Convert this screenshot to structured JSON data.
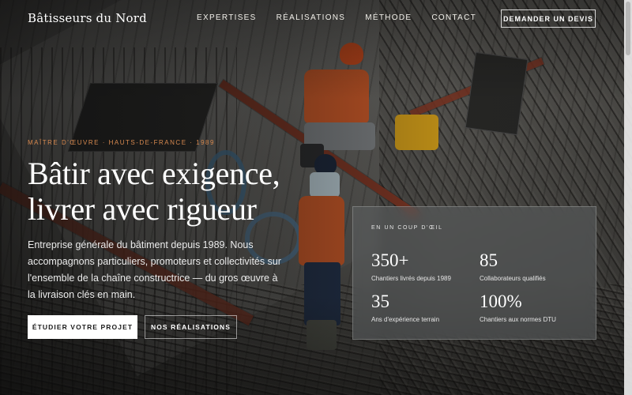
{
  "header": {
    "logo": "Bâtisseurs du Nord",
    "nav": [
      "EXPERTISES",
      "RÉALISATIONS",
      "MÉTHODE",
      "CONTACT"
    ],
    "cta": "DEMANDER UN DEVIS"
  },
  "hero": {
    "eyebrow": "MAÎTRE D'ŒUVRE · HAUTS-DE-FRANCE · 1989",
    "title_line1": "Bâtir avec exigence,",
    "title_line2": "livrer avec rigueur",
    "lead": "Entreprise générale du bâtiment depuis 1989. Nous accompagnons particuliers, promoteurs et collectivités sur l'ensemble de la chaîne constructrice — du gros œuvre à la livraison clés en main.",
    "primary_button": "ÉTUDIER VOTRE PROJET",
    "secondary_button": "NOS RÉALISATIONS"
  },
  "stats_card": {
    "label": "EN UN COUP D'ŒIL",
    "stats": [
      {
        "value": "350+",
        "label": "Chantiers livrés depuis 1989"
      },
      {
        "value": "85",
        "label": "Collaborateurs qualifiés"
      },
      {
        "value": "35",
        "label": "Ans d'expérience terrain"
      },
      {
        "value": "100%",
        "label": "Chantiers aux normes DTU"
      }
    ]
  },
  "colors": {
    "accent": "#d7894f",
    "text": "#ffffff",
    "button_bg": "#ffffff"
  }
}
